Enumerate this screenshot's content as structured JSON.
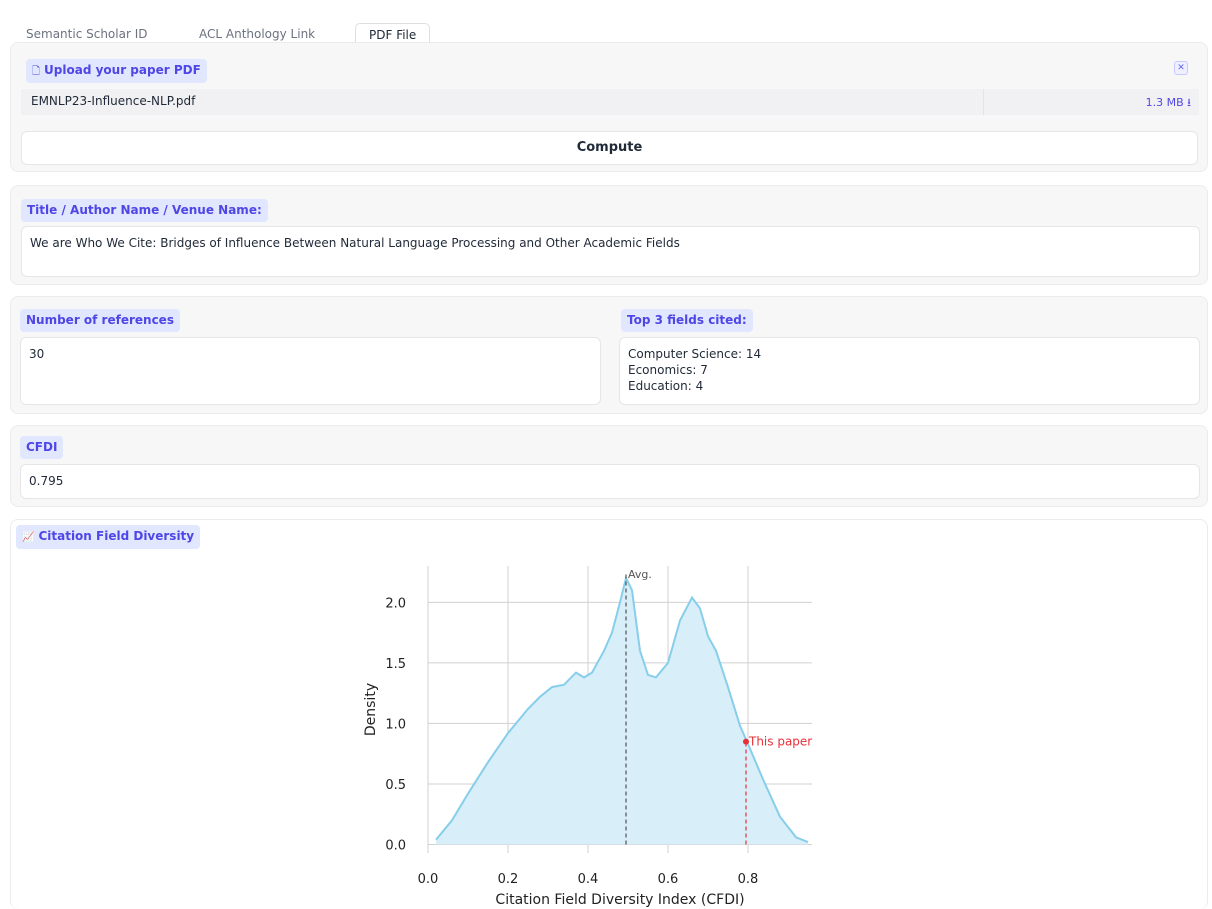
{
  "tabs": [
    {
      "label": "Semantic Scholar ID"
    },
    {
      "label": "ACL Anthology Link"
    },
    {
      "label": "PDF File"
    }
  ],
  "upload": {
    "label": "Upload your paper PDF",
    "file_name": "EMNLP23-Influence-NLP.pdf",
    "file_size": "1.3 MB ⭳"
  },
  "compute_label": "Compute",
  "title_block": {
    "label": "Title / Author Name / Venue Name:",
    "value": "We are Who We Cite: Bridges of Influence Between Natural Language Processing and Other Academic Fields"
  },
  "references": {
    "label": "Number of references",
    "value": "30"
  },
  "top_fields": {
    "label": "Top 3 fields cited:",
    "lines": [
      "Computer Science: 14",
      "Economics: 7",
      "Education: 4"
    ]
  },
  "cfdi": {
    "label": "CFDI",
    "value": "0.795"
  },
  "plot_label": "Citation Field Diversity",
  "colors": {
    "accent": "#4f46e5",
    "chip_bg": "#e0e7ff",
    "density_line": "#87ceeb",
    "density_fill": "#d8eef8",
    "marker": "#e8303a"
  },
  "chart_data": {
    "type": "area",
    "xlabel": "Citation Field Diversity Index (CFDI)",
    "ylabel": "Density",
    "xlim": [
      0.0,
      0.96
    ],
    "ylim": [
      -0.07,
      2.3
    ],
    "xticks": [
      0.0,
      0.2,
      0.4,
      0.6,
      0.8
    ],
    "yticks": [
      0.0,
      0.5,
      1.0,
      1.5,
      2.0
    ],
    "grid": true,
    "series": [
      {
        "x": [
          0.02,
          0.06,
          0.1,
          0.15,
          0.2,
          0.25,
          0.28,
          0.31,
          0.34,
          0.37,
          0.39,
          0.41,
          0.44,
          0.46,
          0.48,
          0.495,
          0.51,
          0.53,
          0.55,
          0.57,
          0.6,
          0.63,
          0.66,
          0.68,
          0.7,
          0.72,
          0.75,
          0.78,
          0.8,
          0.84,
          0.88,
          0.92,
          0.95
        ],
        "y": [
          0.04,
          0.2,
          0.42,
          0.68,
          0.92,
          1.12,
          1.22,
          1.3,
          1.32,
          1.42,
          1.38,
          1.42,
          1.6,
          1.75,
          2.0,
          2.2,
          2.1,
          1.6,
          1.4,
          1.38,
          1.5,
          1.85,
          2.04,
          1.95,
          1.72,
          1.6,
          1.3,
          0.98,
          0.83,
          0.52,
          0.23,
          0.06,
          0.02
        ]
      }
    ],
    "avg": {
      "x": 0.495,
      "label": "Avg."
    },
    "this_paper": {
      "x": 0.795,
      "y": 0.85,
      "label": "This paper"
    }
  }
}
